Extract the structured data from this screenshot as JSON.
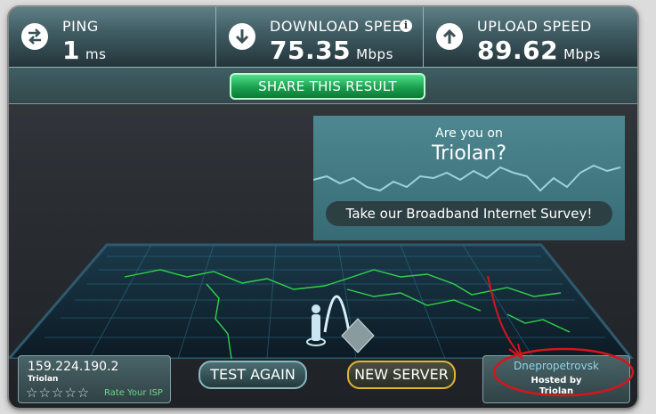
{
  "stats": {
    "ping": {
      "label": "PING",
      "value": "1",
      "unit": "ms",
      "icon": "swap-arrows-icon"
    },
    "download": {
      "label": "DOWNLOAD SPEED",
      "value": "75.35",
      "unit": "Mbps",
      "icon": "download-arrow-icon"
    },
    "upload": {
      "label": "UPLOAD SPEED",
      "value": "89.62",
      "unit": "Mbps",
      "icon": "upload-arrow-icon"
    }
  },
  "share": {
    "label": "SHARE THIS RESULT"
  },
  "survey": {
    "question": "Are you on",
    "isp": "Triolan?",
    "cta": "Take our Broadband Internet Survey!"
  },
  "footer": {
    "ip": "159.224.190.2",
    "isp": "Triolan",
    "stars": "☆☆☆☆☆",
    "rate_label": "Rate Your ISP",
    "test_again": "TEST AGAIN",
    "new_server": "NEW SERVER",
    "server_city": "Dnepropetrovsk",
    "hosted_by": "Hosted by",
    "host": "Triolan"
  },
  "colors": {
    "accent_green": "#1aa04e",
    "annotation_red": "#d9141b",
    "map_line_green": "#31d24b",
    "grid_cyan": "#3aa6c6"
  }
}
